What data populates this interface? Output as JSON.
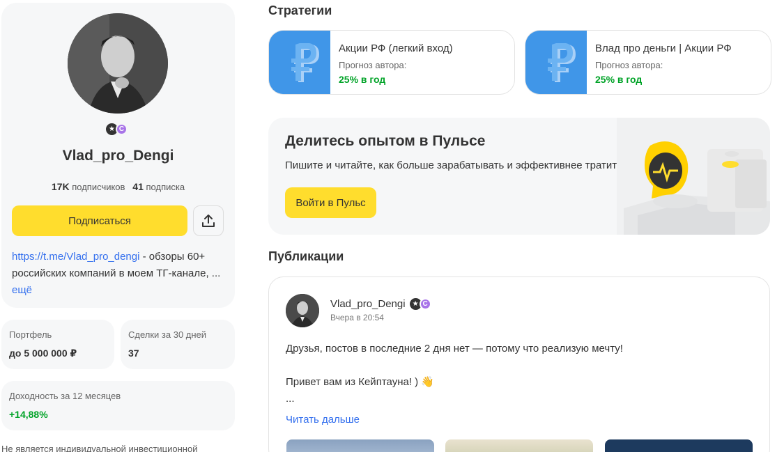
{
  "profile": {
    "name": "Vlad_pro_Dengi",
    "subscribers_count": "17K",
    "subscribers_label": "подписчиков",
    "subscriptions_count": "41",
    "subscriptions_label": "подписка",
    "subscribe_label": "Подписаться",
    "bio_link": "https://t.me/Vlad_pro_dengi",
    "bio_text": " - обзоры 60+ российских компаний в моем ТГ-канале, ...",
    "bio_more": "ещё"
  },
  "stats": {
    "portfolio_label": "Портфель",
    "portfolio_value": "до 5 000 000 ₽",
    "deals_label": "Сделки за 30 дней",
    "deals_value": "37",
    "yield_label": "Доходность за 12 месяцев",
    "yield_value": "+14,88%"
  },
  "disclaimer": "Не является индивидуальной инвестиционной",
  "strategies": {
    "title": "Стратегии",
    "items": [
      {
        "name": "Акции РФ (легкий вход)",
        "forecast_label": "Прогноз автора:",
        "forecast_value": "25% в год"
      },
      {
        "name": "Влад про деньги | Акции РФ",
        "forecast_label": "Прогноз автора:",
        "forecast_value": "25% в год"
      }
    ]
  },
  "pulse": {
    "title": "Делитесь опытом в Пульсе",
    "subtitle": "Пишите и читайте, как больше зарабатывать и эффективнее тратить",
    "button_label": "Войти в Пульс"
  },
  "publications": {
    "title": "Публикации",
    "post": {
      "author": "Vlad_pro_Dengi",
      "time": "Вчера в 20:54",
      "line1": "Друзья, постов в последние 2 дня нет — потому что реализую мечту!",
      "line2": "Привет вам из Кейптауна! ) 👋",
      "line3": "...",
      "read_more": "Читать дальше"
    }
  },
  "colors": {
    "accent_yellow": "#ffdd2d",
    "link_blue": "#336fee",
    "positive_green": "#00a327",
    "strategy_blue": "#4096e8"
  }
}
